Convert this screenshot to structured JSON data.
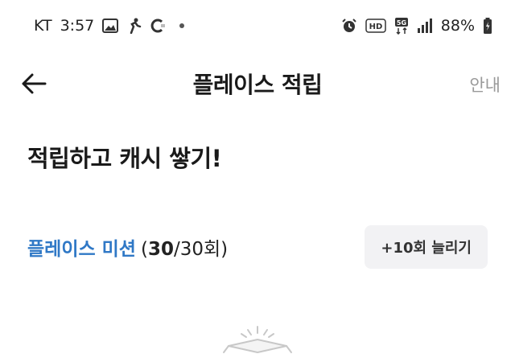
{
  "status_bar": {
    "carrier": "KT",
    "time": "3:57",
    "battery": "88%",
    "left_icons": [
      "gallery-icon",
      "walk-icon",
      "app-icon"
    ],
    "right_icons": [
      "alarm-icon",
      "hd-icon",
      "5g-icon",
      "signal-icon",
      "battery-icon"
    ],
    "network_badge": "HD",
    "network_type": "5G"
  },
  "app_bar": {
    "title": "플레이스 적립",
    "guide_label": "안내"
  },
  "headline": "적립하고 캐시 쌓기!",
  "mission": {
    "name": "플레이스 미션",
    "open_paren": "(",
    "done": "30",
    "total": "/30회",
    "close_paren": ")",
    "increase_button": "+10회 늘리기"
  },
  "colors": {
    "accent": "#2f78c6",
    "guide_text": "#9a9a9a",
    "button_bg": "#f2f2f4"
  }
}
